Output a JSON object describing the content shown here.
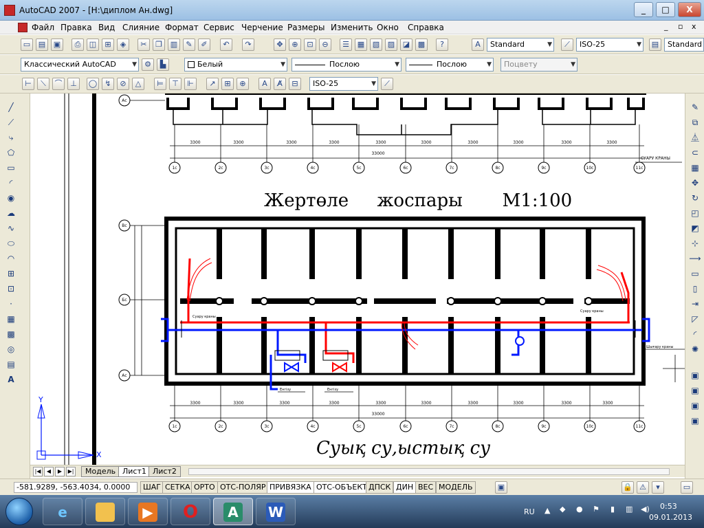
{
  "window": {
    "title": "AutoCAD 2007 - [H:\\диплом Ан.dwg]",
    "controls": [
      "_",
      "□",
      "X"
    ]
  },
  "menu": [
    "Файл",
    "Правка",
    "Вид",
    "Слияние",
    "Формат",
    "Сервис",
    "Черчение",
    "Размеры",
    "Изменить",
    "Окно",
    "Справка"
  ],
  "toolbar1": {
    "text_style": "Standard",
    "dim_style": "ISO-25",
    "table_style": "Standard"
  },
  "toolbar2": {
    "workspace": "Классический AutoCAD",
    "color": "Белый",
    "linetype": "Послою",
    "lineweight": "Послою",
    "plotstyle": "Поцвету"
  },
  "toolbar3": {
    "dim_style": "ISO-25"
  },
  "drawing": {
    "plan_title": "Жертөле     жоспары       М1:100",
    "bottom_title": "Суық су,ыстық су",
    "dims_top": [
      "3300",
      "3300",
      "3300",
      "3300",
      "3300",
      "3300",
      "3300",
      "3300",
      "3300",
      "3300"
    ],
    "dims_top_total": "33000",
    "dims_bottom": [
      "3300",
      "3300",
      "3300",
      "3300",
      "3300",
      "3300",
      "3300",
      "3300",
      "3300",
      "3300"
    ],
    "dims_bottom_total": "33000",
    "axis_labels": [
      "1с",
      "2с",
      "3с",
      "4с",
      "5с",
      "6с",
      "7с",
      "8с",
      "9с",
      "10с",
      "11с"
    ],
    "row_labels": [
      "Вс",
      "Бс",
      "Ас"
    ],
    "right_label_top": "СУАРУ КРАНЫ",
    "right_label_pipe": "Шығару краны",
    "left_label_pipe": "Суару краны",
    "entry_labels": [
      "Енгізу",
      "Енгізу"
    ],
    "ucs_x": "X",
    "ucs_y": "Y"
  },
  "tabs": [
    "Модель",
    "Лист1",
    "Лист2"
  ],
  "active_tab": "Лист1",
  "status": {
    "coords": "-581.9289, -563.4034, 0.0000",
    "buttons": [
      "ШАГ",
      "СЕТКА",
      "ОРТО",
      "ОТС-ПОЛЯР",
      "ПРИВЯЗКА",
      "ОТС-ОБЪЕКТ",
      "ДПСК",
      "ДИН",
      "ВЕС",
      "МОДЕЛЬ"
    ]
  },
  "taskbar": {
    "lang": "RU",
    "time": "0:53",
    "date": "09.01.2013"
  },
  "colors": {
    "cold_pipe": "#0018ff",
    "hot_pipe": "#ff0000"
  }
}
